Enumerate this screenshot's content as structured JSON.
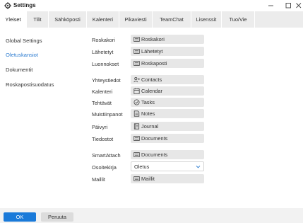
{
  "window": {
    "title": "Settings",
    "icon": "gear-icon",
    "controls": [
      "minimize-icon",
      "maximize-icon",
      "close-icon"
    ]
  },
  "tabs": [
    {
      "label": "Yleiset",
      "active": true
    },
    {
      "label": "Tilit",
      "active": false
    },
    {
      "label": "Sähköposti",
      "active": false
    },
    {
      "label": "Kalenteri",
      "active": false
    },
    {
      "label": "Pikaviesti",
      "active": false
    },
    {
      "label": "TeamChat",
      "active": false
    },
    {
      "label": "Lisenssit",
      "active": false
    },
    {
      "label": "Tuo/Vie",
      "active": false
    }
  ],
  "sidebar": {
    "items": [
      {
        "label": "Global Settings",
        "active": false
      },
      {
        "label": "Oletuskansiot",
        "active": true
      },
      {
        "label": "Dokumentit",
        "active": false
      },
      {
        "label": "Roskapostisuodatus",
        "active": false
      }
    ]
  },
  "rows": {
    "roskakori": {
      "label": "Roskakori",
      "value": "Roskakori",
      "icon": "folder-icon"
    },
    "lahetetyt": {
      "label": "Lähetetyt",
      "value": "Lähetetyt",
      "icon": "folder-icon"
    },
    "luonnokset": {
      "label": "Luonnokset",
      "value": "Roskaposti",
      "icon": "folder-icon"
    },
    "yhteystiedot": {
      "label": "Yhteystiedot",
      "value": "Contacts",
      "icon": "contacts-icon"
    },
    "kalenteri": {
      "label": "Kalenteri",
      "value": "Calendar",
      "icon": "calendar-icon"
    },
    "tehtavat": {
      "label": "Tehtävät",
      "value": "Tasks",
      "icon": "task-check-icon"
    },
    "muistiinpanot": {
      "label": "Muistiinpanot",
      "value": "Notes",
      "icon": "note-icon"
    },
    "paivyri": {
      "label": "Päivyri",
      "value": "Journal",
      "icon": "journal-icon"
    },
    "tiedostot": {
      "label": "Tiedostot",
      "value": "Documents",
      "icon": "folder-icon"
    },
    "smartattach": {
      "label": "SmartAttach",
      "value": "Documents",
      "icon": "folder-icon"
    },
    "osoitekirja": {
      "label": "Osoitekirja",
      "value": "Oletus",
      "icon": "chevron-down-icon"
    },
    "maillit": {
      "label": "Maillit",
      "value": "Maillit",
      "icon": "folder-icon"
    }
  },
  "footer": {
    "ok_label": "OK",
    "cancel_label": "Peruuta"
  },
  "colors": {
    "accent": "#1a7ad9",
    "active_link": "#2b7bd0",
    "tabbar": "#ececec",
    "field_bg": "#e7e7e7"
  }
}
